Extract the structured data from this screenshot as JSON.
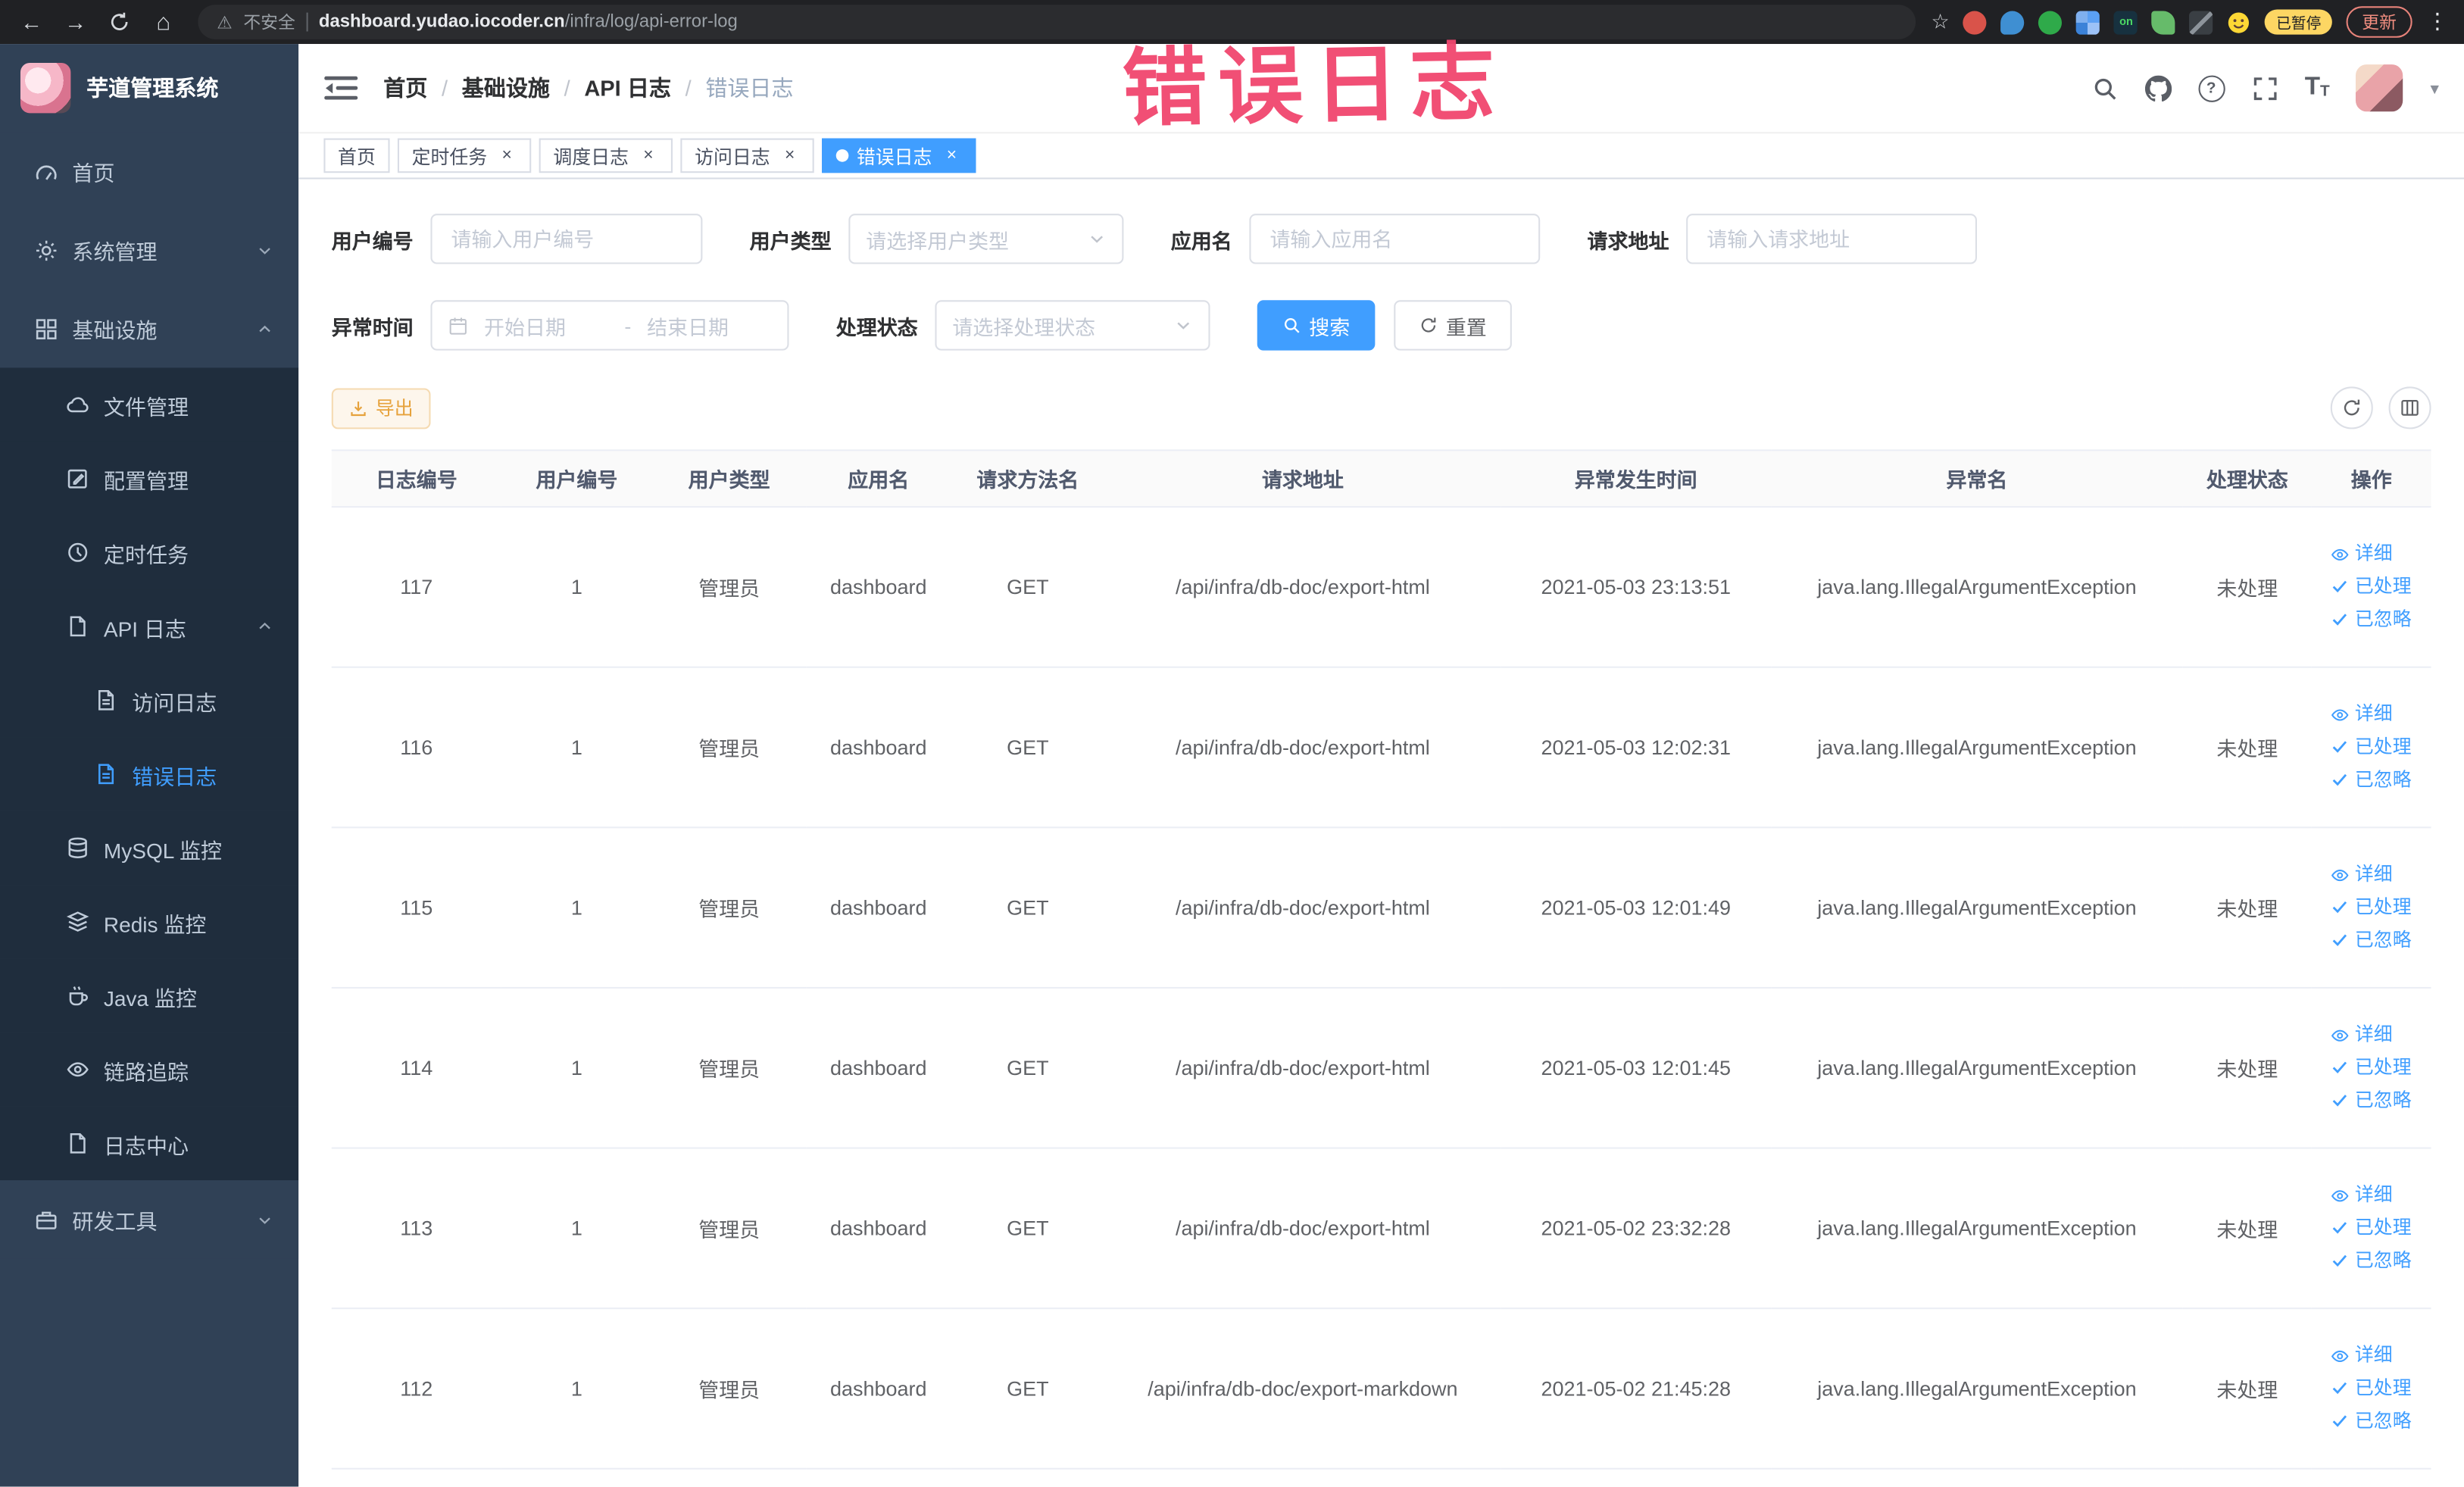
{
  "browser": {
    "security_label": "不安全",
    "url_domain": "dashboard.yudao.iocoder.cn",
    "url_path": "/infra/log/api-error-log",
    "extension_on_text": "on",
    "paused_badge": "已暂停",
    "update_button": "更新"
  },
  "annotation": {
    "text": "错误日志"
  },
  "sidebar": {
    "logo_title": "芋道管理系统",
    "items": [
      {
        "name": "home",
        "label": "首页",
        "icon": "gauge-icon",
        "level": 1
      },
      {
        "name": "system",
        "label": "系统管理",
        "icon": "gear-icon",
        "level": 1,
        "chevron": "down"
      },
      {
        "name": "infra",
        "label": "基础设施",
        "icon": "grid-icon",
        "level": 1,
        "chevron": "up"
      },
      {
        "name": "file-manage",
        "label": "文件管理",
        "icon": "cloud-icon",
        "level": 2
      },
      {
        "name": "config-manage",
        "label": "配置管理",
        "icon": "edit-icon",
        "level": 2
      },
      {
        "name": "job",
        "label": "定时任务",
        "icon": "clock-icon",
        "level": 2
      },
      {
        "name": "api-log",
        "label": "API 日志",
        "icon": "doc-icon",
        "level": 2,
        "chevron": "up"
      },
      {
        "name": "access-log",
        "label": "访问日志",
        "icon": "doc-lines-icon",
        "level": 3
      },
      {
        "name": "error-log",
        "label": "错误日志",
        "icon": "doc-lines-icon",
        "level": 3,
        "active": true
      },
      {
        "name": "mysql-monitor",
        "label": "MySQL 监控",
        "icon": "database-icon",
        "level": 2
      },
      {
        "name": "redis-monitor",
        "label": "Redis 监控",
        "icon": "layers-icon",
        "level": 2
      },
      {
        "name": "java-monitor",
        "label": "Java 监控",
        "icon": "cup-icon",
        "level": 2
      },
      {
        "name": "trace",
        "label": "链路追踪",
        "icon": "eye-icon",
        "level": 2
      },
      {
        "name": "log-center",
        "label": "日志中心",
        "icon": "doc-icon",
        "level": 2
      },
      {
        "name": "devtools",
        "label": "研发工具",
        "icon": "briefcase-icon",
        "level": 1,
        "chevron": "down"
      }
    ]
  },
  "header": {
    "breadcrumb": [
      "首页",
      "基础设施",
      "API 日志",
      "错误日志"
    ],
    "breadcrumb_separator": "/"
  },
  "tabs": [
    {
      "name": "home",
      "label": "首页",
      "closable": false,
      "active": false
    },
    {
      "name": "job",
      "label": "定时任务",
      "closable": true,
      "active": false
    },
    {
      "name": "job-log",
      "label": "调度日志",
      "closable": true,
      "active": false
    },
    {
      "name": "access-log",
      "label": "访问日志",
      "closable": true,
      "active": false
    },
    {
      "name": "error-log",
      "label": "错误日志",
      "closable": true,
      "active": true
    }
  ],
  "filters": {
    "user_id_label": "用户编号",
    "user_id_placeholder": "请输入用户编号",
    "user_type_label": "用户类型",
    "user_type_placeholder": "请选择用户类型",
    "app_name_label": "应用名",
    "app_name_placeholder": "请输入应用名",
    "request_url_label": "请求地址",
    "request_url_placeholder": "请输入请求地址",
    "exception_time_label": "异常时间",
    "date_start_placeholder": "开始日期",
    "date_separator": "-",
    "date_end_placeholder": "结束日期",
    "process_status_label": "处理状态",
    "process_status_placeholder": "请选择处理状态",
    "search_button": "搜索",
    "reset_button": "重置"
  },
  "toolbar": {
    "export_button": "导出"
  },
  "table": {
    "columns": [
      "日志编号",
      "用户编号",
      "用户类型",
      "应用名",
      "请求方法名",
      "请求地址",
      "异常发生时间",
      "异常名",
      "处理状态",
      "操作"
    ],
    "actions": {
      "detail": "详细",
      "processed": "已处理",
      "ignored": "已忽略"
    },
    "rows": [
      {
        "id": "117",
        "user_id": "1",
        "user_type": "管理员",
        "app_name": "dashboard",
        "method": "GET",
        "url": "/api/infra/db-doc/export-html",
        "time": "2021-05-03 23:13:51",
        "exception": "java.lang.IllegalArgumentException",
        "status": "未处理"
      },
      {
        "id": "116",
        "user_id": "1",
        "user_type": "管理员",
        "app_name": "dashboard",
        "method": "GET",
        "url": "/api/infra/db-doc/export-html",
        "time": "2021-05-03 12:02:31",
        "exception": "java.lang.IllegalArgumentException",
        "status": "未处理"
      },
      {
        "id": "115",
        "user_id": "1",
        "user_type": "管理员",
        "app_name": "dashboard",
        "method": "GET",
        "url": "/api/infra/db-doc/export-html",
        "time": "2021-05-03 12:01:49",
        "exception": "java.lang.IllegalArgumentException",
        "status": "未处理"
      },
      {
        "id": "114",
        "user_id": "1",
        "user_type": "管理员",
        "app_name": "dashboard",
        "method": "GET",
        "url": "/api/infra/db-doc/export-html",
        "time": "2021-05-03 12:01:45",
        "exception": "java.lang.IllegalArgumentException",
        "status": "未处理"
      },
      {
        "id": "113",
        "user_id": "1",
        "user_type": "管理员",
        "app_name": "dashboard",
        "method": "GET",
        "url": "/api/infra/db-doc/export-html",
        "time": "2021-05-02 23:32:28",
        "exception": "java.lang.IllegalArgumentException",
        "status": "未处理"
      },
      {
        "id": "112",
        "user_id": "1",
        "user_type": "管理员",
        "app_name": "dashboard",
        "method": "GET",
        "url": "/api/infra/db-doc/export-markdown",
        "time": "2021-05-02 21:45:28",
        "exception": "java.lang.IllegalArgumentException",
        "status": "未处理"
      }
    ]
  }
}
